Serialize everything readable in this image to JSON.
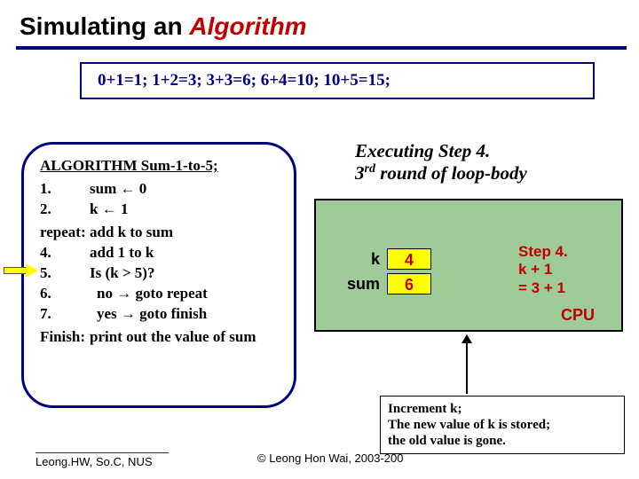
{
  "title": {
    "pre": "Simulating an ",
    "accent": "Algorithm"
  },
  "sums": "0+1=1;  1+2=3;  3+3=6;  6+4=10;  10+5=15;",
  "algo": {
    "heading": "ALGORITHM Sum-1-to-5;",
    "lines": [
      {
        "num": "1.",
        "txt": "sum ← 0"
      },
      {
        "num": "2.",
        "txt": "k ← 1"
      },
      {
        "num": "repeat:",
        "txt": "add k to sum"
      },
      {
        "num": "4.",
        "txt": "add 1 to k"
      },
      {
        "num": "5.",
        "txt": "Is (k > 5)?"
      },
      {
        "num": "6.",
        "txt": " no → goto repeat"
      },
      {
        "num": "7.",
        "txt": " yes → goto finish"
      },
      {
        "num": "Finish:",
        "txt": "print out the value of sum"
      }
    ]
  },
  "exec": {
    "line1": "Executing Step 4.",
    "line2a": " 3",
    "line2sup": "rd",
    "line2b": " round of loop-body"
  },
  "vars": {
    "k_label": "k",
    "k_value": "4",
    "sum_label": "sum",
    "sum_value": "6"
  },
  "step_note": {
    "a": "Step 4.",
    "b": " k + 1",
    "c": " = 3 + 1"
  },
  "cpu_label": "CPU",
  "note": {
    "l1": "Increment k;",
    "l2": "The new value of k is stored;",
    "l3": "the old value is gone."
  },
  "footer_left": "Leong.HW, So.C, NUS",
  "footer_center": "© Leong Hon Wai, 2003-200"
}
